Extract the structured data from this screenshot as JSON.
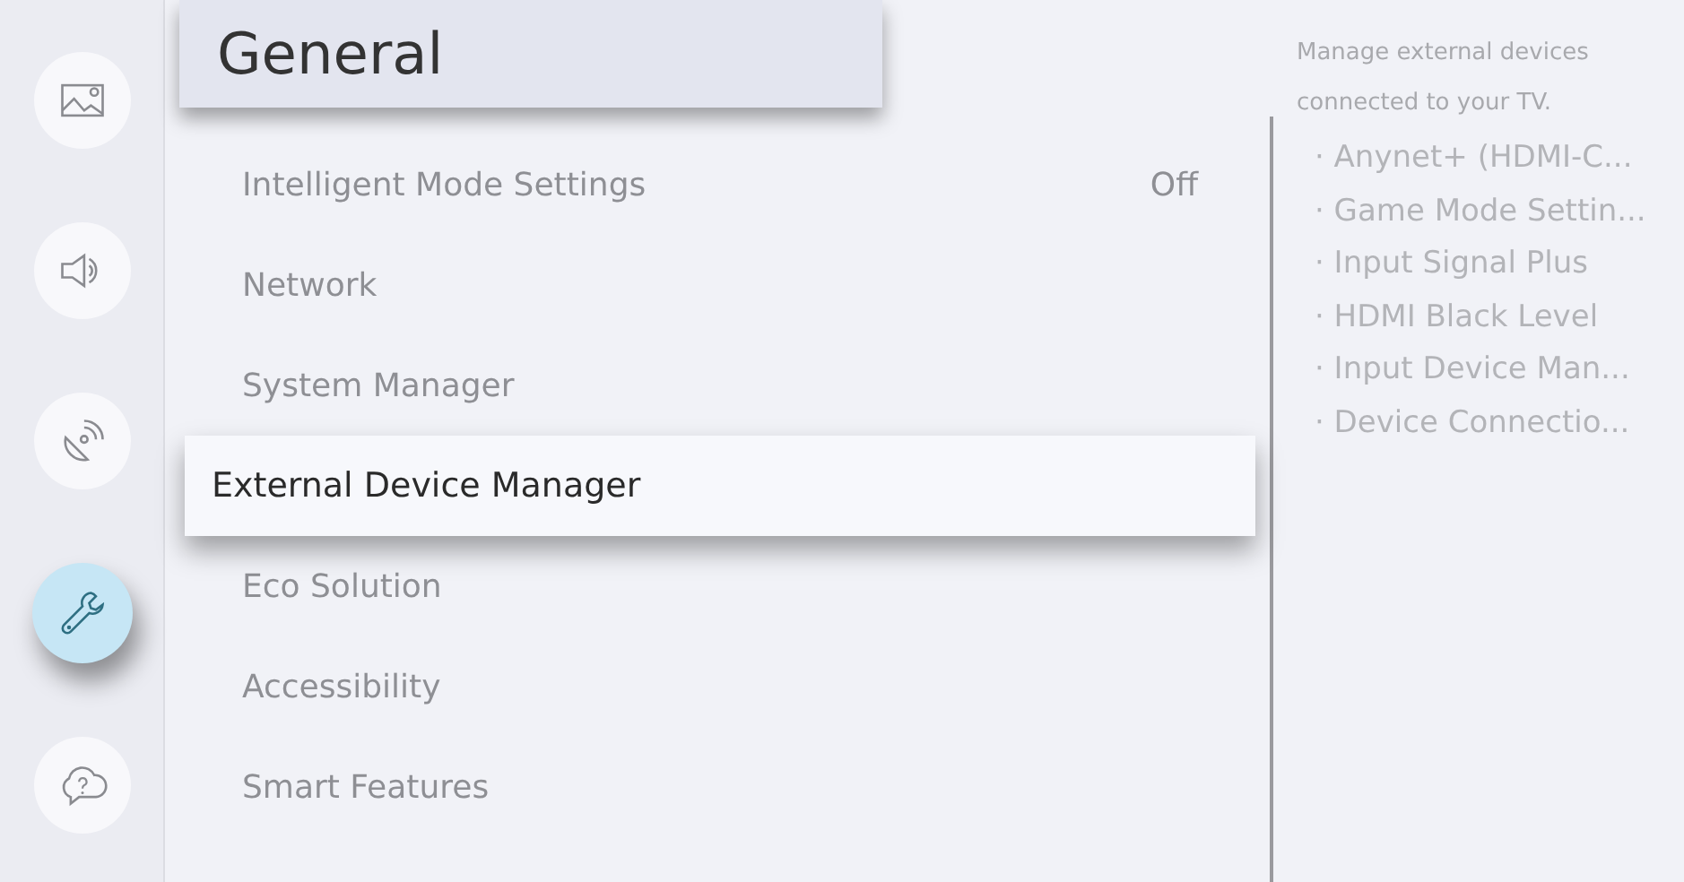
{
  "sidebar": {
    "items": [
      {
        "kind": "picture",
        "selected": false
      },
      {
        "kind": "sound",
        "selected": false
      },
      {
        "kind": "broadcast",
        "selected": false
      },
      {
        "kind": "wrench",
        "selected": true
      },
      {
        "kind": "support",
        "selected": false
      }
    ]
  },
  "menu": {
    "title": "General",
    "items": [
      {
        "label": "Intelligent Mode Settings",
        "value": "Off",
        "selected": false
      },
      {
        "label": "Network",
        "selected": false
      },
      {
        "label": "System Manager",
        "selected": false
      },
      {
        "label": "External Device Manager",
        "selected": true
      },
      {
        "label": "Eco Solution",
        "selected": false
      },
      {
        "label": "Accessibility",
        "selected": false
      },
      {
        "label": "Smart Features",
        "selected": false
      }
    ]
  },
  "info": {
    "description": "Manage external devices connected to your TV.",
    "items": [
      "· Anynet+ (HDMI-C...",
      "· Game Mode Settin...",
      "· Input Signal Plus",
      "· HDMI Black Level",
      "· Input Device Man...",
      "· Device Connectio..."
    ]
  }
}
